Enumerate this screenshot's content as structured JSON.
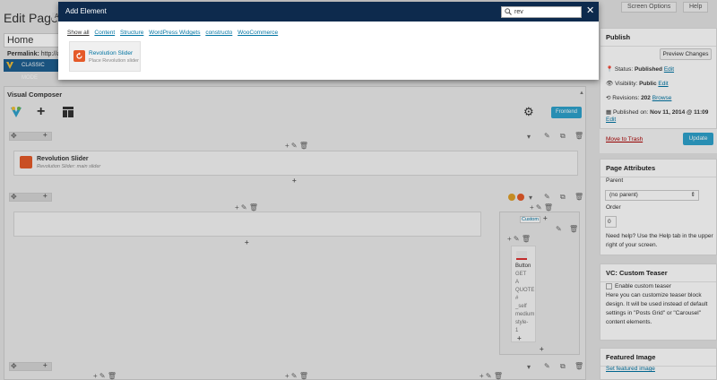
{
  "page": {
    "title": "Edit Page",
    "add_new": "Ad",
    "screen_options": "Screen Options",
    "help": "Help",
    "post_title": "Home",
    "permalink_label": "Permalink:",
    "permalink_value": "http://ar",
    "classic_mode": "CLASSIC MODE"
  },
  "visual_composer": {
    "title": "Visual Composer",
    "frontend_button": "Frontend",
    "rows": [
      {
        "element_title": "Revolution Slider",
        "element_sub": "Revolution Slider: main slider"
      }
    ],
    "nested": {
      "tab_label": "Custom",
      "button_text": [
        "Button",
        "GET",
        "A",
        "QUOTE",
        "#",
        "_self",
        "medium",
        "style-",
        "1"
      ]
    }
  },
  "sidebar": {
    "publish": {
      "title": "Publish",
      "preview_button": "Preview Changes",
      "status_label": "Status:",
      "status_value": "Published",
      "status_edit": "Edit",
      "visibility_label": "Visibility:",
      "visibility_value": "Public",
      "visibility_edit": "Edit",
      "revisions_label": "Revisions:",
      "revisions_count": "202",
      "revisions_browse": "Browse",
      "published_label": "Published on:",
      "published_value": "Nov 11, 2014 @ 11:09",
      "published_edit": "Edit",
      "trash": "Move to Trash",
      "update": "Update"
    },
    "page_attributes": {
      "title": "Page Attributes",
      "parent_label": "Parent",
      "parent_value": "(no parent)",
      "order_label": "Order",
      "order_value": "0",
      "help_text": "Need help? Use the Help tab in the upper right of your screen."
    },
    "custom_teaser": {
      "title": "VC: Custom Teaser",
      "checkbox_label": "Enable custom teaser",
      "description": "Here you can customize teaser block design. It will be used instead of default settings in \"Posts Grid\" or \"Carousel\" content elements."
    },
    "featured_image": {
      "title": "Featured Image",
      "link": "Set featured image"
    }
  },
  "modal": {
    "title": "Add Element",
    "search_value": "rev",
    "tabs": [
      "Show all",
      "Content",
      "Structure",
      "WordPress Widgets",
      "constructo",
      "WooCommerce"
    ],
    "results": [
      {
        "name": "Revolution Slider",
        "description": "Place Revolution slider"
      }
    ]
  },
  "colors": {
    "modal_header": "#0d2a4d",
    "accent_blue": "#2ea2cc",
    "link": "#0074a2",
    "revslider_icon": "#e55a29",
    "trash": "#a00"
  }
}
